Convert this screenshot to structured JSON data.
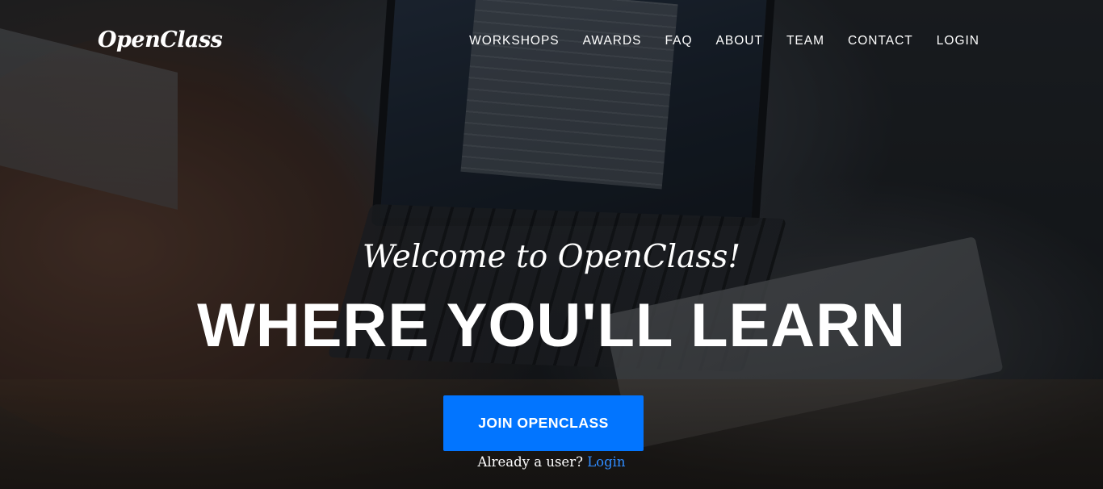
{
  "brand": "OpenClass",
  "nav": {
    "items": [
      {
        "label": "WORKSHOPS"
      },
      {
        "label": "AWARDS"
      },
      {
        "label": "FAQ"
      },
      {
        "label": "ABOUT"
      },
      {
        "label": "TEAM"
      },
      {
        "label": "CONTACT"
      },
      {
        "label": "LOGIN"
      }
    ]
  },
  "hero": {
    "subheading": "Welcome to OpenClass!",
    "heading": "WHERE YOU'LL LEARN",
    "join_button": "JOIN OPENCLASS",
    "already_text": "Already a user?",
    "login_link": "Login"
  },
  "colors": {
    "accent": "#0275ff",
    "link": "#2f8cff",
    "text": "#ffffff"
  }
}
